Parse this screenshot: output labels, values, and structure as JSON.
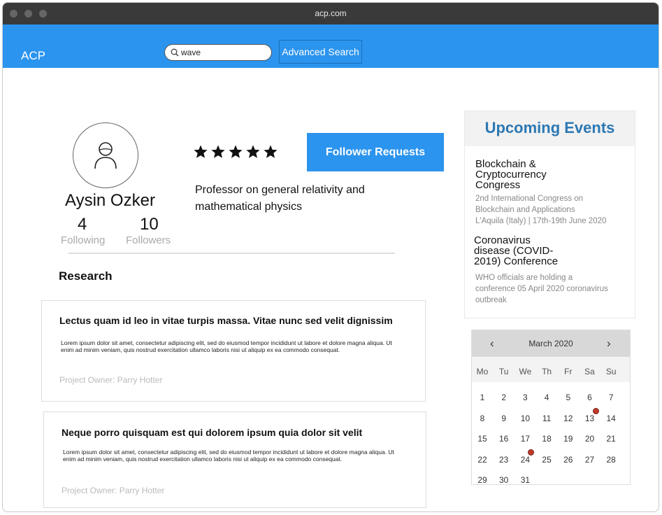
{
  "browser": {
    "url": "acp.com"
  },
  "header": {
    "logo": "ACP",
    "search": {
      "value": "wave",
      "placeholder": ""
    },
    "advanced_search_label": "Advanced Search"
  },
  "profile": {
    "name": "Aysin Ozker",
    "following_count": "4",
    "following_label": "Following",
    "followers_count": "10",
    "followers_label": "Followers",
    "rating": 5,
    "bio": "Professor on general relativity and mathematical physics",
    "follower_requests_label": "Follower Requests"
  },
  "research": {
    "title": "Research",
    "items": [
      {
        "title": "Lectus quam id leo in vitae turpis massa. Vitae nunc sed velit dignissim",
        "body": "Lorem ipsum dolor sit amet, consectetur adipiscing elit, sed do eiusmod tempor incididunt ut labore et dolore magna aliqua. Ut enim ad minim veniam, quis nostrud exercitation ullamco laboris nisi ut aliquip ex ea commodo consequat.",
        "owner": "Project Owner: Parry Hotter"
      },
      {
        "title": "Neque porro quisquam est qui dolorem ipsum quia dolor sit velit",
        "body": "Lorem ipsum dolor sit amet, consectetur adipiscing elit, sed do eiusmod tempor incididunt ut labore et dolore magna aliqua. Ut enim ad minim veniam, quis nostrud exercitation ullamco laboris nisi ut aliquip ex ea commodo consequat.",
        "owner": "Project Owner: Parry Hotter"
      }
    ]
  },
  "events": {
    "title": "Upcoming Events",
    "items": [
      {
        "title_lines": [
          "Blockchain &",
          "Cryptocurrency",
          "Congress"
        ],
        "desc_lines": [
          "2nd International Congress on",
          "Blockchain and Applications",
          "L'Aquila (Italy) | 17th-19th June 2020"
        ]
      },
      {
        "title_lines": [
          "Coronavirus",
          "disease (COVID-",
          "2019) Conference"
        ],
        "desc_lines": [
          "WHO officials are holding a",
          "conference 05 April 2020 coronavirus",
          "outbreak"
        ]
      }
    ]
  },
  "calendar": {
    "month_label": "March 2020",
    "prev_icon": "‹",
    "next_icon": "›",
    "weekdays": [
      "Mo",
      "Tu",
      "We",
      "Th",
      "Fr",
      "Sa",
      "Su"
    ],
    "first_weekday_index": 0,
    "days_in_month": 31,
    "event_days": [
      13,
      24
    ],
    "event_color": "#c0392b"
  }
}
